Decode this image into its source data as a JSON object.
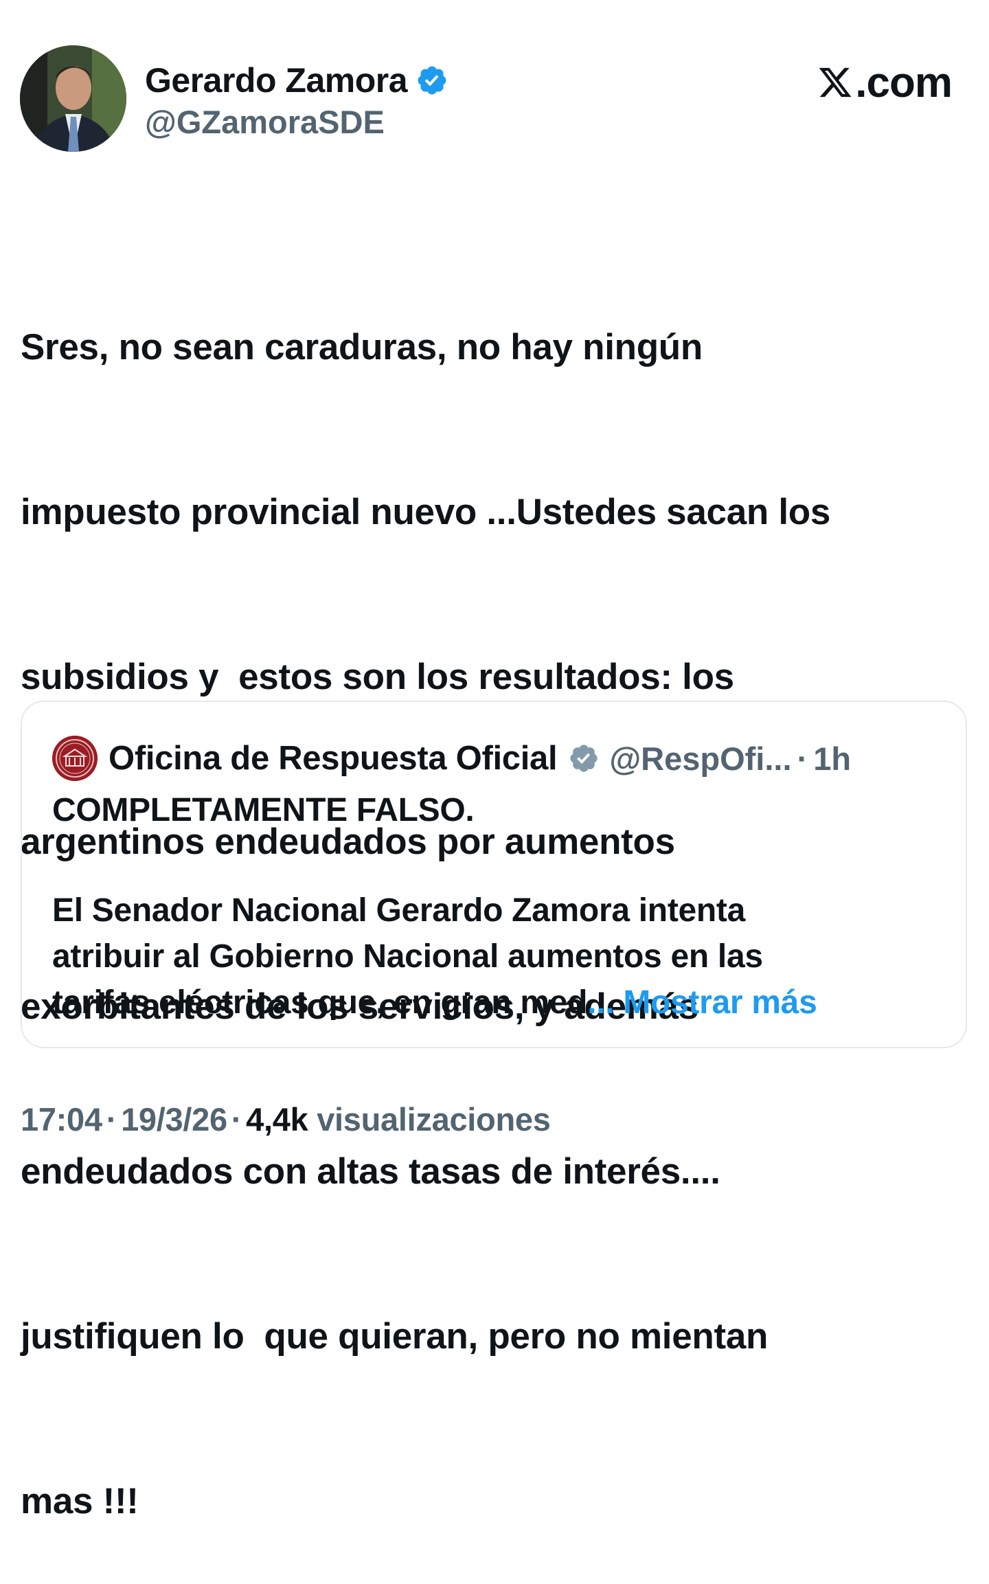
{
  "author": {
    "display_name": "Gerardo Zamora",
    "handle": "@GZamoraSDE",
    "avatar_icon": "profile-photo",
    "verified_icon": "verified-badge-icon"
  },
  "brand": {
    "label": ".com",
    "icon": "x-logo-icon"
  },
  "tweet": {
    "lines": [
      "Sres, no sean caraduras, no hay ningún",
      "impuesto provincial nuevo ...Ustedes sacan los",
      "subsidios y  estos son los resultados: los",
      "argentinos endeudados por aumentos",
      "exorbitantes de los servicios, y además",
      "endeudados con altas tasas de interés....",
      "justifiquen lo  que quieran, pero no mientan",
      "mas !!!"
    ]
  },
  "quote": {
    "name": "Oficina de Respuesta Oficial",
    "handle": "@RespOfi...",
    "separator": "·",
    "time": "1h",
    "headline": "COMPLETAMENTE FALSO.",
    "body_lines": [
      "El Senador Nacional Gerardo Zamora intenta",
      "atribuir al Gobierno Nacional aumentos en las",
      "tarifas eléctricas que, en gran med"
    ],
    "more_label": "... Mostrar más",
    "verified_icon": "verified-badge-gray-icon",
    "avatar_icon": "institution-seal-icon"
  },
  "footer": {
    "time": "17:04",
    "date": "19/3/26",
    "views_count": "4,4k",
    "views_label": "visualizaciones",
    "separator": "·"
  },
  "colors": {
    "text_primary": "#0f1419",
    "text_secondary": "#536471",
    "accent_blue": "#1d9bf0",
    "border": "#e6e9ec",
    "seal_red": "#9b1c23"
  }
}
